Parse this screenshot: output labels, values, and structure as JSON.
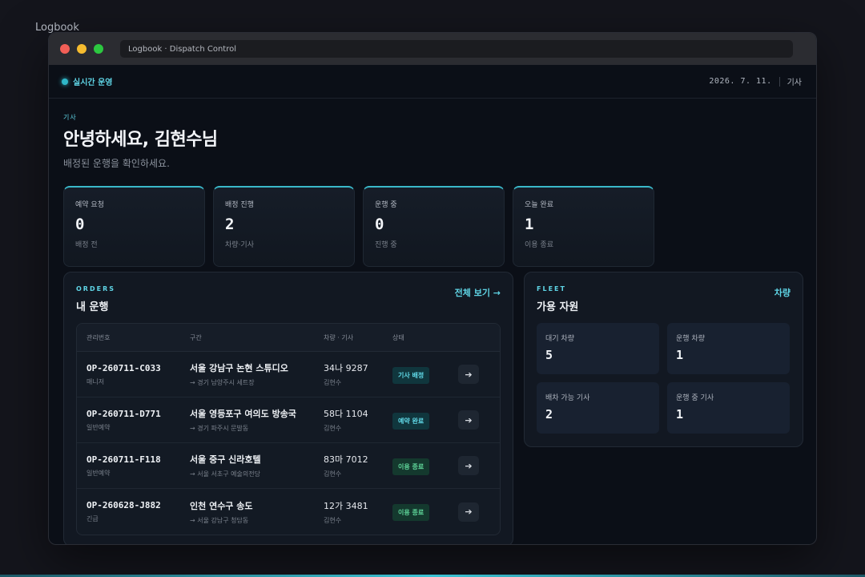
{
  "app_label": "Logbook",
  "window": {
    "url": "Logbook · Dispatch Control"
  },
  "topbar": {
    "live": "실시간 운영",
    "date": "2026. 7. 11.",
    "role": "기사"
  },
  "header": {
    "role": "기사",
    "greeting": "안녕하세요, 김현수님",
    "subtitle": "배정된 운행을 확인하세요."
  },
  "stats": [
    {
      "label": "예약 요청",
      "value": "0",
      "sub": "배정 전"
    },
    {
      "label": "배정 진행",
      "value": "2",
      "sub": "차량·기사"
    },
    {
      "label": "운행 중",
      "value": "0",
      "sub": "진행 중"
    },
    {
      "label": "오늘 완료",
      "value": "1",
      "sub": "이용 종료"
    }
  ],
  "orders": {
    "eyebrow": "ORDERS",
    "title": "내 운행",
    "link": "전체 보기 →",
    "columns": [
      "관리번호",
      "구간",
      "차량 · 기사",
      "상태"
    ],
    "rows": [
      {
        "id": "OP-260711-C033",
        "type": "매니저",
        "route": "서울 강남구 논현 스튜디오",
        "dest": "→ 경기 남양주시 세트장",
        "plate": "34나 9287",
        "driver": "김현수",
        "status": "기사 배정"
      },
      {
        "id": "OP-260711-D771",
        "type": "일반예약",
        "route": "서울 영등포구 여의도 방송국",
        "dest": "→ 경기 파주시 문발동",
        "plate": "58다 1104",
        "driver": "김현수",
        "status": "예약 완료"
      },
      {
        "id": "OP-260711-F118",
        "type": "일반예약",
        "route": "서울 중구 신라호텔",
        "dest": "→ 서울 서초구 예술의전당",
        "plate": "83마 7012",
        "driver": "김현수",
        "status": "이용 종료"
      },
      {
        "id": "OP-260628-J882",
        "type": "긴급",
        "route": "인천 연수구 송도",
        "dest": "→ 서울 강남구 청담동",
        "plate": "12가 3481",
        "driver": "김현수",
        "status": "이용 종료"
      }
    ]
  },
  "fleet": {
    "eyebrow": "FLEET",
    "title": "가용 자원",
    "link": "차량",
    "cards": [
      {
        "label": "대기 차량",
        "value": "5"
      },
      {
        "label": "운행 차량",
        "value": "1"
      },
      {
        "label": "배차 가능 기사",
        "value": "2"
      },
      {
        "label": "운행 중 기사",
        "value": "1"
      }
    ]
  }
}
